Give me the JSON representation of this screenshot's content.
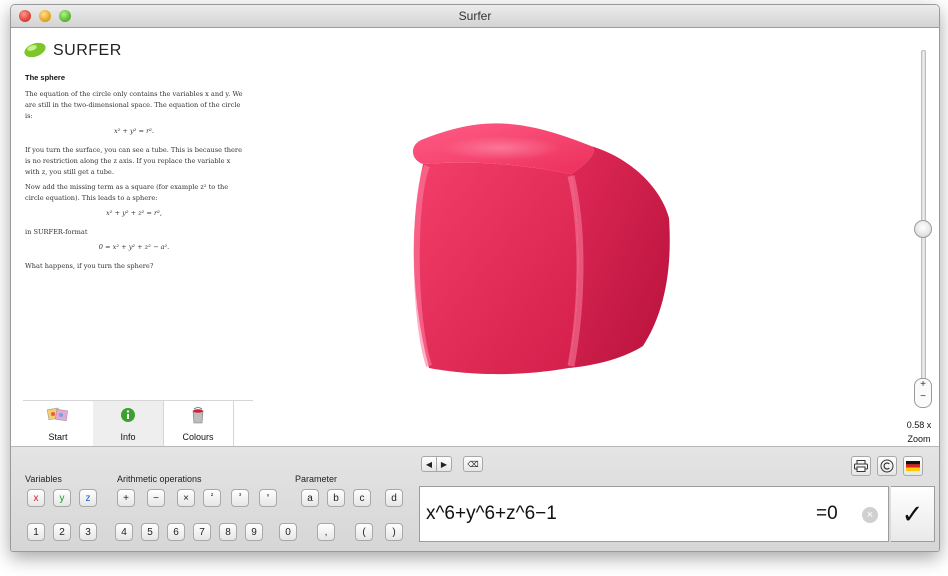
{
  "window": {
    "title": "Surfer"
  },
  "app": {
    "logo_text": "SURFER"
  },
  "info": {
    "heading": "The sphere",
    "p1": "The equation of the circle only contains the variables x and y. We are still in the two-dimensional space. The equation of the circle is:",
    "eq1": "x² + y² = r².",
    "p2": "If you turn the surface, you can see a tube. This is because there is no restriction along the z axis. If you replace the variable x with z, you still get a tube.",
    "p3": "Now add the missing term as a square (for example z² to the circle equation). This leads to a sphere:",
    "eq2": "x² + y² + z² = r²,",
    "p4": "in SURFER-format",
    "eq3": "0 = x² + y² + z² − a².",
    "p5": "What happens, if you turn the sphere?"
  },
  "tabs": [
    {
      "label": "Start",
      "icon": "gallery-icon"
    },
    {
      "label": "Info",
      "icon": "info-icon"
    },
    {
      "label": "Colours",
      "icon": "paint-bucket-icon"
    }
  ],
  "zoom": {
    "value": "0.58 x",
    "label": "Zoom",
    "plus": "+",
    "minus": "−",
    "position": 0.4
  },
  "keyboard": {
    "variables_label": "Variables",
    "arith_label": "Arithmetic operations",
    "param_label": "Parameter",
    "variables": [
      "x",
      "y",
      "z"
    ],
    "arith": [
      "+",
      "−",
      "×",
      "²",
      "³",
      "ⁿ"
    ],
    "params": [
      "a",
      "b",
      "c",
      "d"
    ],
    "digits": [
      "1",
      "2",
      "3",
      "4",
      "5",
      "6",
      "7",
      "8",
      "9",
      "0",
      ",",
      "(",
      ")"
    ]
  },
  "editor": {
    "left": "◀",
    "right": "▶",
    "delete": "⌫",
    "equation": "x^6+y^6+z^6−1",
    "rhs": "=0",
    "clear": "×",
    "confirm": "✓"
  },
  "colors": {
    "surface": "#e8305c"
  }
}
